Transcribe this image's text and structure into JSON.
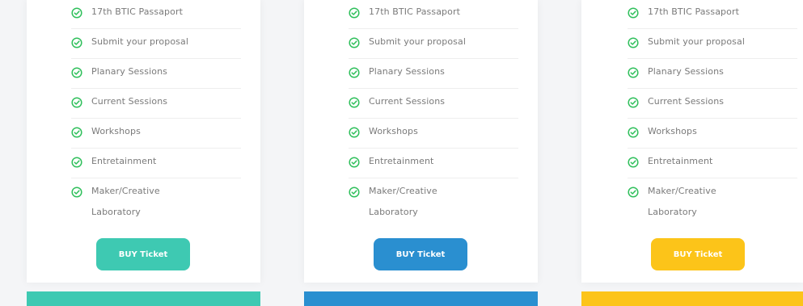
{
  "colors": {
    "check": "#2fbf5b",
    "card1_accent": "#3ec9b2",
    "card2_accent": "#2a8fd0",
    "card3_accent": "#fcc419"
  },
  "plans": [
    {
      "features": [
        "17th BTIC Passaport",
        "Submit your proposal",
        "Planary Sessions",
        "Current Sessions",
        "Workshops",
        "Entretainment",
        "Maker/Creative Laboratory"
      ],
      "button": "BUY Ticket"
    },
    {
      "features": [
        "17th BTIC Passaport",
        "Submit your proposal",
        "Planary Sessions",
        "Current Sessions",
        "Workshops",
        "Entretainment",
        "Maker/Creative Laboratory"
      ],
      "button": "BUY Ticket"
    },
    {
      "features": [
        "17th BTIC Passaport",
        "Submit your proposal",
        "Planary Sessions",
        "Current Sessions",
        "Workshops",
        "Entretainment",
        "Maker/Creative Laboratory"
      ],
      "button": "BUY Ticket"
    }
  ],
  "icons": {
    "feature": "check-circle-icon"
  }
}
